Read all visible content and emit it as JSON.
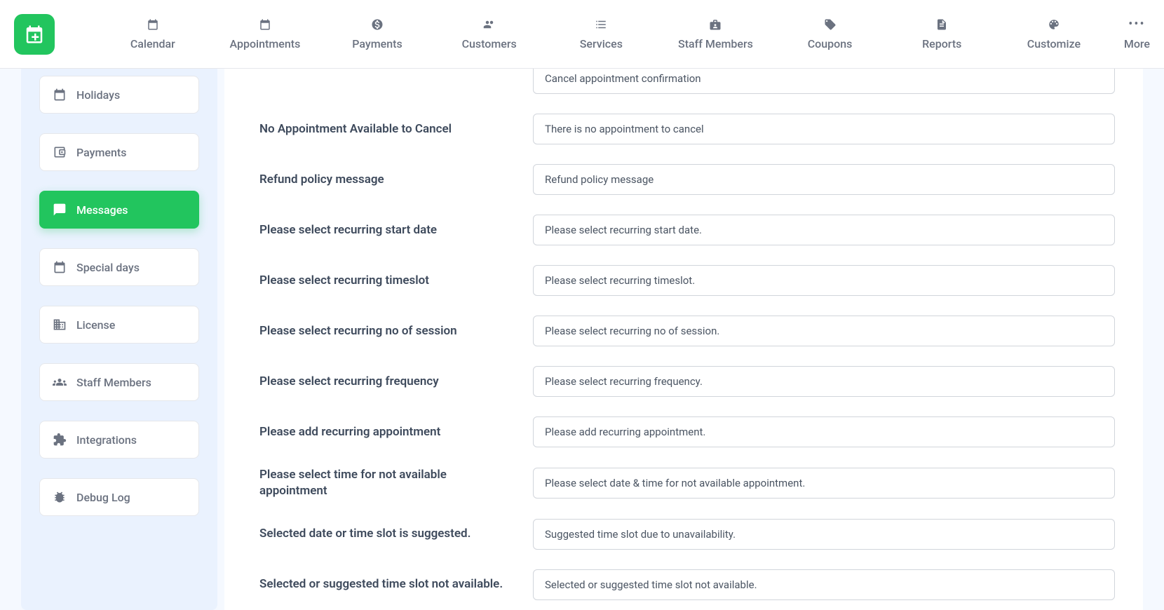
{
  "nav": {
    "items": [
      {
        "label": "Calendar",
        "icon": "calendar"
      },
      {
        "label": "Appointments",
        "icon": "calendar-check"
      },
      {
        "label": "Payments",
        "icon": "dollar"
      },
      {
        "label": "Customers",
        "icon": "users"
      },
      {
        "label": "Services",
        "icon": "list"
      },
      {
        "label": "Staff Members",
        "icon": "badge"
      },
      {
        "label": "Coupons",
        "icon": "tag"
      },
      {
        "label": "Reports",
        "icon": "document"
      },
      {
        "label": "Customize",
        "icon": "palette"
      }
    ],
    "more": "More"
  },
  "sidebar": {
    "items": [
      {
        "label": "Holidays",
        "icon": "calendar"
      },
      {
        "label": "Payments",
        "icon": "wallet"
      },
      {
        "label": "Messages",
        "icon": "chat",
        "active": true
      },
      {
        "label": "Special days",
        "icon": "calendar"
      },
      {
        "label": "License",
        "icon": "building"
      },
      {
        "label": "Staff Members",
        "icon": "users"
      },
      {
        "label": "Integrations",
        "icon": "puzzle"
      },
      {
        "label": "Debug Log",
        "icon": "bug"
      }
    ]
  },
  "form": {
    "rows": [
      {
        "label": "",
        "value": "Cancel appointment confirmation"
      },
      {
        "label": "No Appointment Available to Cancel",
        "value": "There is no appointment to cancel"
      },
      {
        "label": "Refund policy message",
        "value": "Refund policy message"
      },
      {
        "label": "Please select recurring start date",
        "value": "Please select recurring start date."
      },
      {
        "label": "Please select recurring timeslot",
        "value": "Please select recurring timeslot."
      },
      {
        "label": "Please select recurring no of session",
        "value": "Please select recurring no of session."
      },
      {
        "label": "Please select recurring frequency",
        "value": "Please select recurring frequency."
      },
      {
        "label": "Please add recurring appointment",
        "value": "Please add recurring appointment."
      },
      {
        "label": "Please select time for not available appointment",
        "value": "Please select date & time for not available appointment."
      },
      {
        "label": "Selected date or time slot is suggested.",
        "value": "Suggested time slot due to unavailability."
      },
      {
        "label": "Selected or suggested time slot not available.",
        "value": "Selected or suggested time slot not available."
      }
    ]
  }
}
